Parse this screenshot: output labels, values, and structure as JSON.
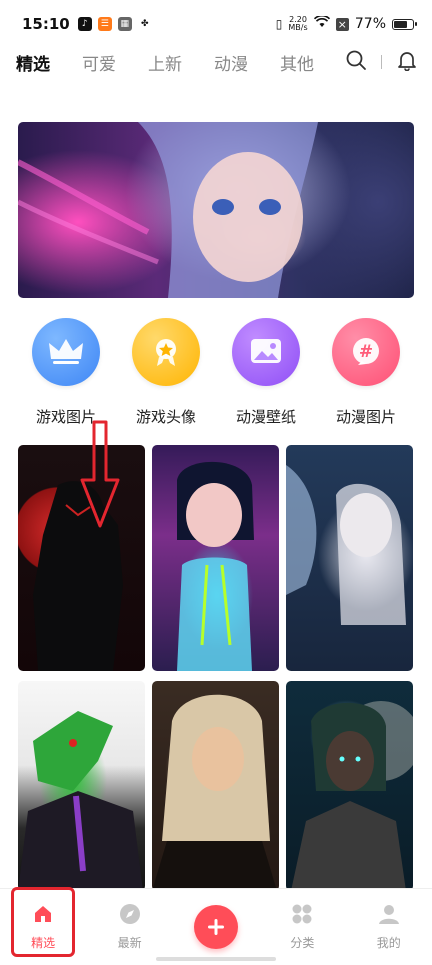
{
  "status_bar": {
    "time": "15:10",
    "net_speed_top": "2.20",
    "net_speed_bottom": "MB/s",
    "battery_text": "77%",
    "battery_level": 0.77,
    "app_icons": [
      "tiktok-icon",
      "orange-app-icon",
      "gray-app-icon",
      "fan-icon"
    ]
  },
  "top_tabs": [
    {
      "label": "精选",
      "active": true
    },
    {
      "label": "可爱",
      "active": false
    },
    {
      "label": "上新",
      "active": false
    },
    {
      "label": "动漫",
      "active": false
    },
    {
      "label": "其他",
      "active": false
    }
  ],
  "categories": [
    {
      "label": "游戏图片",
      "icon": "crown-icon",
      "color": "#4a90ff"
    },
    {
      "label": "游戏头像",
      "icon": "medal-icon",
      "color": "#ffb900"
    },
    {
      "label": "动漫壁纸",
      "icon": "image-icon",
      "color": "#a25bff"
    },
    {
      "label": "动漫图片",
      "icon": "hashtag-icon",
      "color": "#ff5d7a"
    }
  ],
  "bottom_nav": [
    {
      "label": "精选",
      "icon": "home-icon",
      "active": true
    },
    {
      "label": "最新",
      "icon": "compass-icon",
      "active": false
    },
    {
      "label": "",
      "icon": "plus-icon",
      "active": false
    },
    {
      "label": "分类",
      "icon": "grid-icon",
      "active": false
    },
    {
      "label": "我的",
      "icon": "user-icon",
      "active": false
    }
  ],
  "colors": {
    "accent": "#ff4d58",
    "annotation": "#e3262f"
  }
}
